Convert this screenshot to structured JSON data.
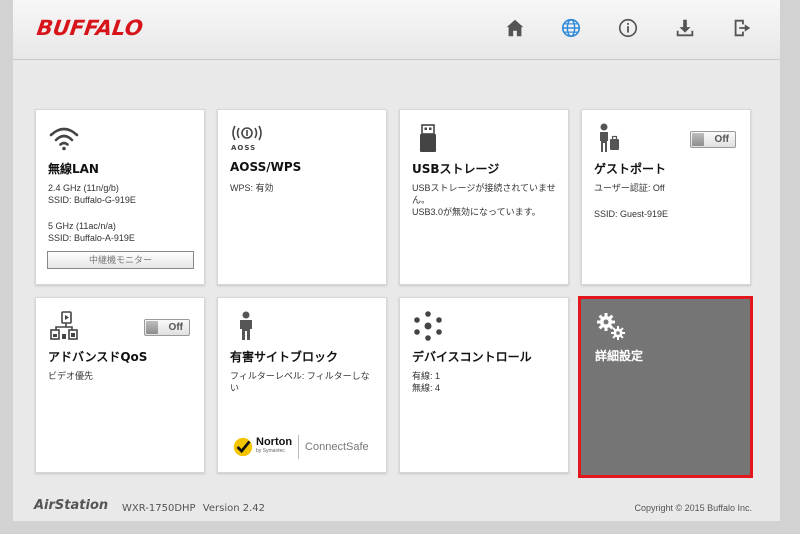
{
  "header": {
    "logo": "BUFFALO",
    "nav": [
      {
        "name": "home-icon"
      },
      {
        "name": "globe-icon"
      },
      {
        "name": "info-icon"
      },
      {
        "name": "download-icon"
      },
      {
        "name": "logout-icon"
      }
    ],
    "active_color": "#2f8ad8"
  },
  "cards": {
    "wlan": {
      "title": "無線LAN",
      "line1": "2.4 GHz (11n/g/b)",
      "line2": "SSID: Buffalo-G-919E",
      "line3": "5 GHz (11ac/n/a)",
      "line4": "SSID: Buffalo-A-919E",
      "button": "中継機モニター"
    },
    "aoss": {
      "icon_label": "AOSS",
      "title": "AOSS/WPS",
      "line1": "WPS: 有効"
    },
    "usb": {
      "title": "USBストレージ",
      "line1": "USBストレージが接続されていません。",
      "line2": "USB3.0が無効になっています。"
    },
    "guest": {
      "title": "ゲストポート",
      "toggle": "Off",
      "line1": "ユーザー認証: Off",
      "line2": "SSID: Guest-919E"
    },
    "qos": {
      "title": "アドバンスドQoS",
      "toggle": "Off",
      "line1": "ビデオ優先"
    },
    "block": {
      "title": "有害サイトブロック",
      "line1": "フィルターレベル: フィルターしない",
      "norton": "Norton",
      "norton_sub": "by Symantec",
      "connectsafe": "ConnectSafe"
    },
    "device": {
      "title": "デバイスコントロール",
      "line1": "有線: 1",
      "line2": "無線: 4"
    },
    "advanced": {
      "title": "詳細設定",
      "highlight_color": "#e3161e"
    }
  },
  "footer": {
    "brand": "AirStation",
    "model": "WXR-1750DHP",
    "version": "Version 2.42",
    "copyright": "Copyright © 2015 Buffalo Inc."
  }
}
